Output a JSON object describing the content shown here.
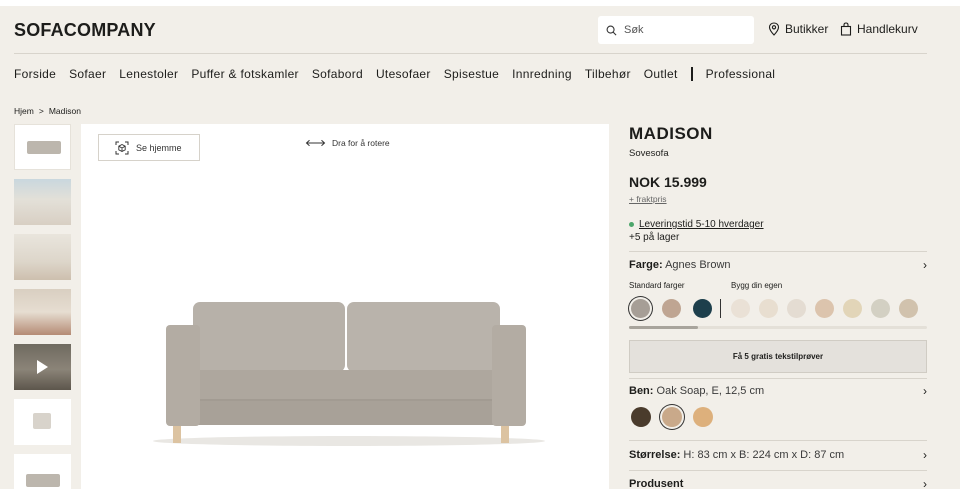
{
  "header": {
    "logo": "SOFACOMPANY",
    "search_placeholder": "Søk",
    "stores_label": "Butikker",
    "cart_label": "Handlekurv"
  },
  "nav": {
    "items": [
      "Forside",
      "Sofaer",
      "Lenestoler",
      "Puffer & fotskamler",
      "Sofabord",
      "Utesofaer",
      "Spisestue",
      "Innredning",
      "Tilbehør",
      "Outlet"
    ],
    "professional": "Professional"
  },
  "breadcrumb": {
    "home": "Hjem",
    "separator": ">",
    "current": "Madison"
  },
  "viewer": {
    "see_home_label": "Se hjemme",
    "rotate_label": "Dra for å rotere"
  },
  "product": {
    "title": "MADISON",
    "subtitle": "Sovesofa",
    "price": "NOK 15.999",
    "freight": "+ fraktpris",
    "delivery": "Leveringstid 5-10 hverdager",
    "stock": "+5 på lager",
    "color_label": "Farge:",
    "color_value": "Agnes Brown",
    "standard_colors_label": "Standard farger",
    "custom_colors_label": "Bygg din egen",
    "samples_button": "Få 5 gratis tekstilprøver",
    "legs_label": "Ben:",
    "legs_value": "Oak Soap, E, 12,5 cm",
    "size_label": "Størrelse:",
    "size_value": "H: 83 cm x B: 224 cm x D: 87 cm",
    "producer_label": "Produsent"
  },
  "swatches": {
    "standard": [
      "#a69e96",
      "#bfa592",
      "#1d3f4c"
    ],
    "custom": [
      "#eae1d6",
      "#e8ded0",
      "#e4dcd2",
      "#dcc4ad",
      "#e2d5b8",
      "#d3d0c3",
      "#d1c2ad"
    ]
  },
  "leg_swatches": [
    "#4a3b2c",
    "#c9a98a",
    "#ddb07c"
  ],
  "colors": {
    "accent_green": "#4ca66b",
    "background": "#f2efe9"
  }
}
